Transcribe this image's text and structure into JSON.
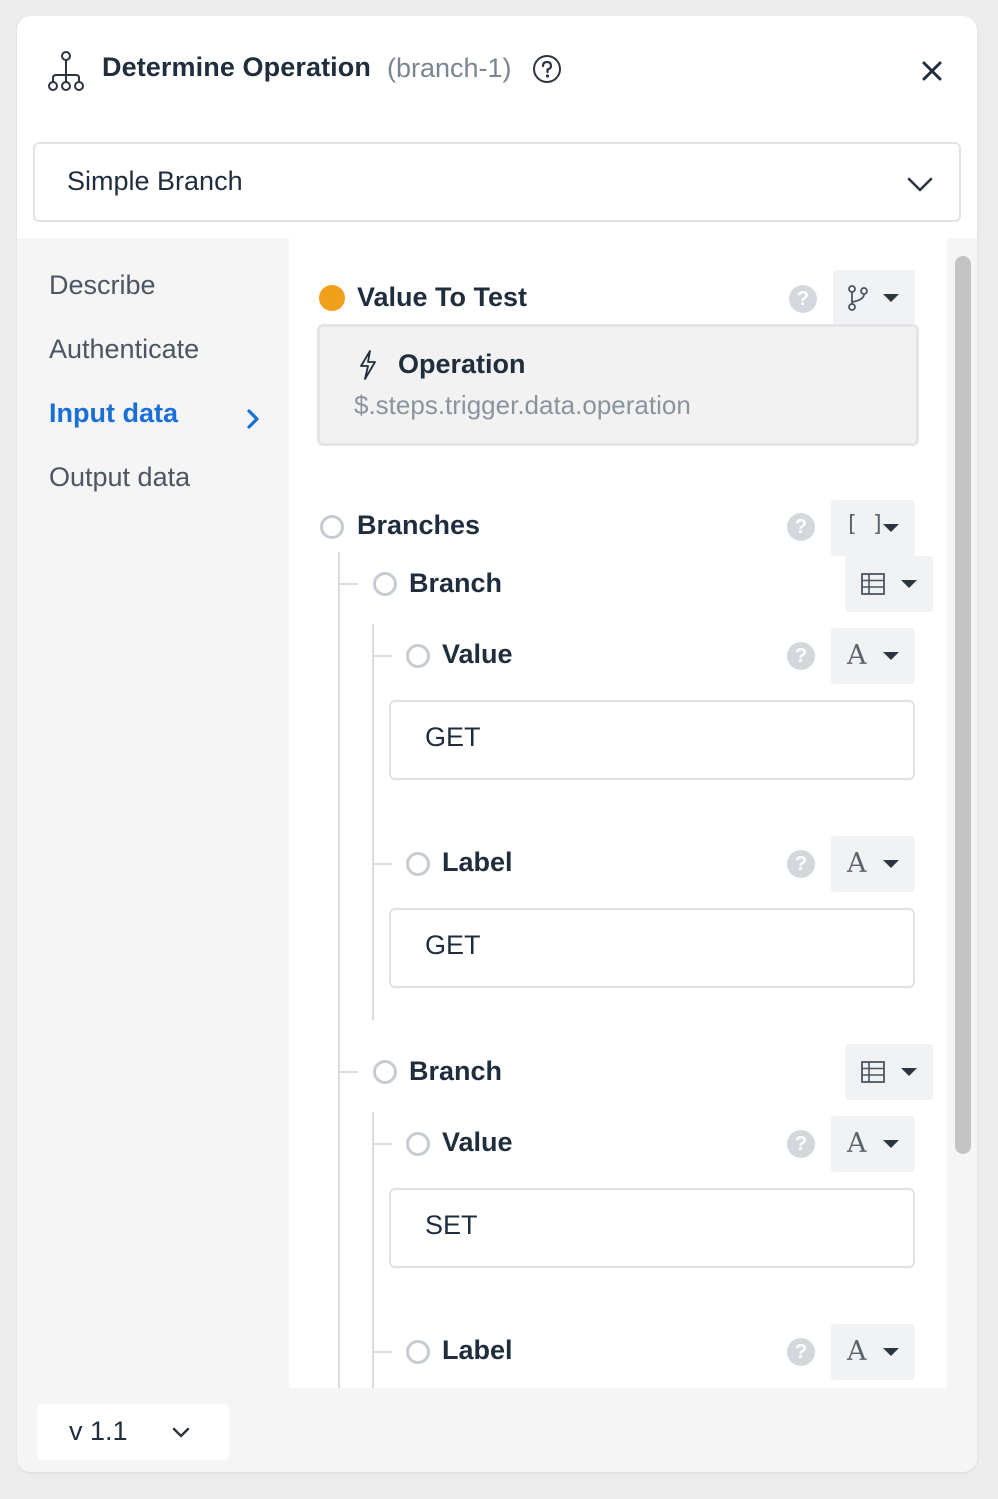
{
  "header": {
    "icon": "workflow-branch-icon",
    "title": "Determine Operation",
    "subtitle": "(branch-1)",
    "help_icon": "question-circle-icon",
    "close_icon": "close-icon"
  },
  "action_select": {
    "value": "Simple Branch",
    "icon": "chevron-down-icon"
  },
  "sidebar": {
    "items": [
      {
        "label": "Describe",
        "active": false
      },
      {
        "label": "Authenticate",
        "active": false
      },
      {
        "label": "Input data",
        "active": true
      },
      {
        "label": "Output data",
        "active": false
      }
    ]
  },
  "fields": {
    "value_to_test": {
      "label": "Value To Test",
      "status_color": "#f0a01a",
      "type_icon": "git-branch-icon",
      "reference": {
        "title": "Operation",
        "path": "$.steps.trigger.data.operation",
        "icon": "lightning-bolt-icon"
      }
    },
    "branches": {
      "label": "Branches",
      "type_icon": "array-brackets-icon",
      "type_glyph": "[ ]",
      "items": [
        {
          "label": "Branch",
          "type_icon": "table-icon",
          "value": {
            "label": "Value",
            "type_glyph": "A",
            "input": "GET"
          },
          "label_field": {
            "label": "Label",
            "type_glyph": "A",
            "input": "GET"
          }
        },
        {
          "label": "Branch",
          "type_icon": "table-icon",
          "value": {
            "label": "Value",
            "type_glyph": "A",
            "input": "SET"
          },
          "label_field": {
            "label": "Label",
            "type_glyph": "A"
          }
        }
      ]
    }
  },
  "help_glyph": "?",
  "footer": {
    "version": "v 1.1"
  },
  "colors": {
    "accent": "#1a6fd6",
    "required": "#f0a01a"
  }
}
